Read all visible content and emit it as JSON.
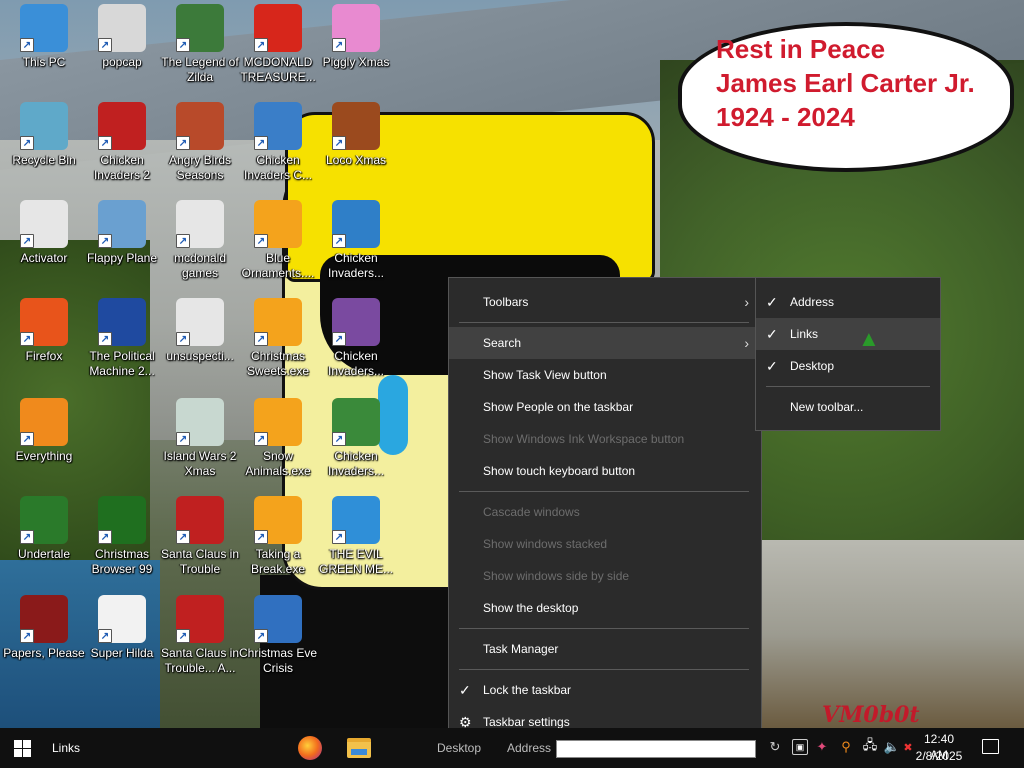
{
  "wallpaper": {
    "bubble_lines": [
      "Rest in Peace",
      "James Earl Carter Jr.",
      "1924 - 2024"
    ],
    "signature": "VM0b0t"
  },
  "desktop_icons": [
    {
      "label": "This PC",
      "icon": "computer-icon",
      "color": "#3a8fd8"
    },
    {
      "label": "popcap",
      "icon": "folder-icon",
      "color": "#d8d8d8"
    },
    {
      "label": "The Legend of Zilda",
      "icon": "game-icon",
      "color": "#3c7a3a"
    },
    {
      "label": "MCDONALD TREASURE...",
      "icon": "mcdonalds-icon",
      "color": "#d7261b"
    },
    {
      "label": "Piggly Xmas",
      "icon": "pig-icon",
      "color": "#e88ad0"
    },
    {
      "label": "Recycle Bin",
      "icon": "recycle-bin-icon",
      "color": "#5fa9c9"
    },
    {
      "label": "Chicken Invaders 2",
      "icon": "chicken-icon",
      "color": "#c02020"
    },
    {
      "label": "Angry Birds Seasons",
      "icon": "angry-bird-icon",
      "color": "#b84a2a"
    },
    {
      "label": "Chicken Invaders C...",
      "icon": "snowman-icon",
      "color": "#3a7ec8"
    },
    {
      "label": "Loco Xmas",
      "icon": "teddy-bear-icon",
      "color": "#9b4a1e"
    },
    {
      "label": "Activator",
      "icon": "file-icon",
      "color": "#e6e6e6"
    },
    {
      "label": "Flappy Plane",
      "icon": "plane-icon",
      "color": "#6aa0d0"
    },
    {
      "label": "mcdonald games",
      "icon": "file-icon",
      "color": "#e6e6e6"
    },
    {
      "label": "Blue Ornaments....",
      "icon": "puzzle-icon",
      "color": "#f4a31c"
    },
    {
      "label": "Chicken Invaders...",
      "icon": "chicken-santa-icon",
      "color": "#2f7fc8"
    },
    {
      "label": "Firefox",
      "icon": "firefox-icon",
      "color": "#e8541b"
    },
    {
      "label": "The Political Machine 2...",
      "icon": "political-icon",
      "color": "#1f4aa0"
    },
    {
      "label": "unsuspecti...",
      "icon": "file-icon",
      "color": "#e6e6e6"
    },
    {
      "label": "Christmas Sweets.exe",
      "icon": "puzzle-icon",
      "color": "#f4a31c"
    },
    {
      "label": "Chicken Invaders...",
      "icon": "chicken-invaders-icon",
      "color": "#7a4aa0"
    },
    {
      "label": "Everything",
      "icon": "magnifier-icon",
      "color": "#f08a1c"
    },
    {
      "label": "Island Wars 2 Xmas",
      "icon": "island-icon",
      "color": "#c8d8d0"
    },
    {
      "label": "Snow Animals.exe",
      "icon": "puzzle-icon",
      "color": "#f4a31c"
    },
    {
      "label": "Chicken Invaders...",
      "icon": "chicken-invaders-icon",
      "color": "#3a8a3a"
    },
    {
      "label": "Undertale",
      "icon": "undertale-icon",
      "color": "#2a7a2a"
    },
    {
      "label": "Christmas Browser 99",
      "icon": "christmas-tree-icon",
      "color": "#1f6f1f"
    },
    {
      "label": "Santa Claus in Trouble",
      "icon": "santa-icon",
      "color": "#c02020"
    },
    {
      "label": "Taking a Break.exe",
      "icon": "puzzle-icon",
      "color": "#f4a31c"
    },
    {
      "label": "THE EVIL GREEN ME...",
      "icon": "messenger-icon",
      "color": "#2f8fd8"
    },
    {
      "label": "Papers, Please",
      "icon": "papers-please-icon",
      "color": "#8a1a1a"
    },
    {
      "label": "Super Hilda",
      "icon": "pixel-icon",
      "color": "#f2f2f2"
    },
    {
      "label": "Santa Claus in Trouble... A...",
      "icon": "santa-icon",
      "color": "#c02020"
    },
    {
      "label": "Christmas Eve Crisis",
      "icon": "santa-icon",
      "color": "#3070c0"
    }
  ],
  "context_menu": {
    "items": [
      {
        "label": "Toolbars",
        "submenu": true
      },
      {
        "label": "Search",
        "submenu": true,
        "highlighted": true
      },
      {
        "label": "Show Task View button"
      },
      {
        "label": "Show People on the taskbar"
      },
      {
        "label": "Show Windows Ink Workspace button",
        "disabled": true
      },
      {
        "label": "Show touch keyboard button"
      },
      {
        "label": "Cascade windows",
        "disabled": true
      },
      {
        "label": "Show windows stacked",
        "disabled": true
      },
      {
        "label": "Show windows side by side",
        "disabled": true
      },
      {
        "label": "Show the desktop"
      },
      {
        "label": "Task Manager"
      },
      {
        "label": "Lock the taskbar",
        "checked": true
      },
      {
        "label": "Taskbar settings",
        "icon": "gear-icon"
      }
    ]
  },
  "toolbars_submenu": {
    "items": [
      {
        "label": "Address",
        "checked": true
      },
      {
        "label": "Links",
        "checked": true,
        "highlighted": true
      },
      {
        "label": "Desktop",
        "checked": true
      },
      {
        "label": "New toolbar..."
      }
    ]
  },
  "taskbar": {
    "links_label": "Links",
    "desktop_label": "Desktop",
    "address_label": "Address",
    "address_value": "",
    "time": "12:40 AM",
    "date": "2/8/2025",
    "tray_icons": [
      "refresh-icon",
      "network-icon",
      "volume-icon",
      "notification-icon"
    ]
  }
}
